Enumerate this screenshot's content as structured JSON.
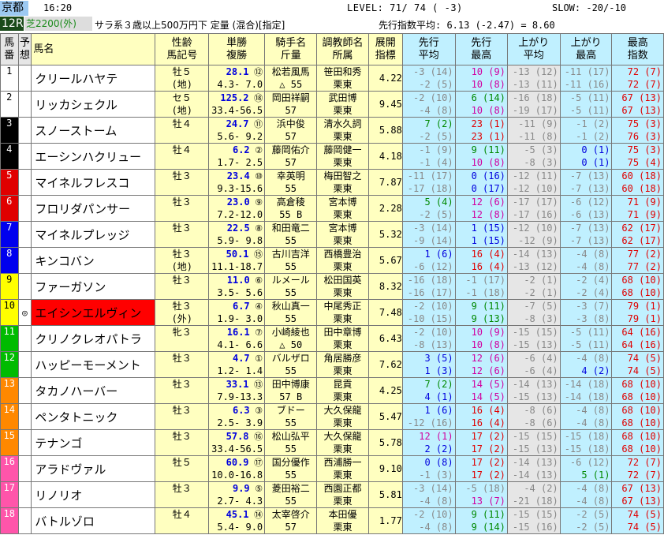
{
  "header": {
    "venue": "京都",
    "time": "16:20",
    "level": "LEVEL:  71/ 74 ( -3)",
    "slow": "SLOW: -20/-10",
    "race": "12R",
    "course": "芝2200(外)",
    "conditions": "サラ系３歳以上500万円下 定量 (混合)[指定]",
    "average": "先行指数平均:  6.13  (-2.47) =  8.60"
  },
  "columns": {
    "num": "馬\n番",
    "pred": "予\n想",
    "name": "馬名",
    "sex": "性齢\n馬記号",
    "odds": "単勝\n複勝",
    "jockey": "騎手名\n斤量",
    "trainer": "調教師名\n所属",
    "devel": "展開\n指標",
    "sa": "先行\n平均",
    "sm": "先行\n最高",
    "aa": "上がり\n平均",
    "am": "上がり\n最高",
    "mx": "最高\n指数"
  },
  "horses": [
    {
      "n": "1",
      "g": "#fff",
      "gt": "dark",
      "mark": "",
      "name": "クリールハヤテ",
      "nbg": "#fff",
      "s1": "牡５",
      "s2": "(地)",
      "o1": "28.1",
      "or": "⑫",
      "o2": "4.3- 7.0",
      "j1": "松若風馬",
      "j2": "△ 55",
      "t1": "笹田和秀",
      "t2": "栗東",
      "dv": "4.22",
      "a1": "-3 (14)",
      "a2": "-2 (5)",
      "b1": "10 (9)",
      "b2": "10 (8)",
      "c1": "-13 (12)",
      "c2": "-13 (11)",
      "d1": "-11 (17)",
      "d2": "-11 (16)",
      "e1": "72 (7)",
      "e2": "72 (7)"
    },
    {
      "n": "2",
      "g": "#fff",
      "gt": "dark",
      "mark": "",
      "name": "リッカシェクル",
      "nbg": "#fff",
      "s1": "セ５",
      "s2": "(地)",
      "o1": "125.2",
      "or": "⑱",
      "o2": "33.4-56.5",
      "j1": "岡田祥嗣",
      "j2": "57",
      "t1": "武田博",
      "t2": "栗東",
      "dv": "9.45",
      "a1": "-2 (10)",
      "a2": "-4 (8)",
      "b1": "6 (14)",
      "b2": "10 (8)",
      "c1": "-16 (18)",
      "c2": "-19 (17)",
      "d1": "-5 (11)",
      "d2": "-5 (11)",
      "e1": "67 (13)",
      "e2": "67 (13)"
    },
    {
      "n": "3",
      "g": "#000",
      "gt": "",
      "mark": "",
      "name": "スノーストーム",
      "nbg": "#fff",
      "s1": "牡４",
      "s2": "",
      "o1": "24.7",
      "or": "⑪",
      "o2": "5.6- 9.2",
      "j1": "浜中俊",
      "j2": "57",
      "t1": "清水久詞",
      "t2": "栗東",
      "dv": "5.88",
      "a1": "7 (2)",
      "a2": "-2 (5)",
      "b1": "23 (1)",
      "b2": "23 (1)",
      "c1": "-11 (9)",
      "c2": "-11 (8)",
      "d1": "-1 (2)",
      "d2": "-1 (2)",
      "e1": "75 (3)",
      "e2": "76 (3)"
    },
    {
      "n": "4",
      "g": "#000",
      "gt": "",
      "mark": "",
      "name": "エーシンハクリュー",
      "nbg": "#fff",
      "s1": "牡４",
      "s2": "",
      "o1": "6.2",
      "or": "②",
      "o2": "1.7- 2.5",
      "j1": "藤岡佑介",
      "j2": "57",
      "t1": "藤岡健一",
      "t2": "栗東",
      "dv": "4.18",
      "a1": "-1 (9)",
      "a2": "-1 (4)",
      "b1": "9 (11)",
      "b2": "10 (8)",
      "c1": "-5 (3)",
      "c2": "-8 (3)",
      "d1": "0 (1)",
      "d2": "0 (1)",
      "e1": "75 (3)",
      "e2": "75 (4)"
    },
    {
      "n": "5",
      "g": "#e00000",
      "gt": "",
      "mark": "",
      "name": "マイネルフレスコ",
      "nbg": "#fff",
      "s1": "牡３",
      "s2": "",
      "o1": "23.4",
      "or": "⑩",
      "o2": "9.3-15.6",
      "j1": "幸英明",
      "j2": "55",
      "t1": "梅田智之",
      "t2": "栗東",
      "dv": "7.87",
      "a1": "-11 (17)",
      "a2": "-17 (18)",
      "b1": "0 (16)",
      "b2": "0 (17)",
      "c1": "-12 (11)",
      "c2": "-12 (10)",
      "d1": "-7 (13)",
      "d2": "-7 (13)",
      "e1": "60 (18)",
      "e2": "60 (18)"
    },
    {
      "n": "6",
      "g": "#e00000",
      "gt": "",
      "mark": "",
      "name": "フロリダパンサー",
      "nbg": "#fff",
      "s1": "牡３",
      "s2": "",
      "o1": "23.0",
      "or": "⑨",
      "o2": "7.2-12.0",
      "j1": "高倉稜",
      "j2": "55 B",
      "t1": "宮本博",
      "t2": "栗東",
      "dv": "2.28",
      "a1": "5 (4)",
      "a2": "-2 (5)",
      "b1": "12 (6)",
      "b2": "12 (8)",
      "c1": "-17 (17)",
      "c2": "-17 (16)",
      "d1": "-6 (12)",
      "d2": "-6 (13)",
      "e1": "71 (9)",
      "e2": "71 (9)"
    },
    {
      "n": "7",
      "g": "#0000ee",
      "gt": "",
      "mark": "",
      "name": "マイネルプレッジ",
      "nbg": "#fff",
      "s1": "牡３",
      "s2": "",
      "o1": "22.5",
      "or": "⑧",
      "o2": "5.9- 9.8",
      "j1": "和田竜二",
      "j2": "55",
      "t1": "宮本博",
      "t2": "栗東",
      "dv": "5.32",
      "a1": "-3 (14)",
      "a2": "-9 (14)",
      "b1": "1 (15)",
      "b2": "1 (15)",
      "c1": "-12 (10)",
      "c2": "-12 (9)",
      "d1": "-7 (13)",
      "d2": "-7 (13)",
      "e1": "62 (17)",
      "e2": "62 (17)"
    },
    {
      "n": "8",
      "g": "#0000ee",
      "gt": "",
      "mark": "",
      "name": "キンコバン",
      "nbg": "#fff",
      "s1": "牡３",
      "s2": "(地)",
      "o1": "50.1",
      "or": "⑮",
      "o2": "11.1-18.7",
      "j1": "古川吉洋",
      "j2": "55",
      "t1": "西橋豊治",
      "t2": "栗東",
      "dv": "5.67",
      "a1": "1 (6)",
      "a2": "-6 (12)",
      "b1": "16 (4)",
      "b2": "16 (4)",
      "c1": "-14 (13)",
      "c2": "-13 (12)",
      "d1": "-4 (8)",
      "d2": "-4 (8)",
      "e1": "77 (2)",
      "e2": "77 (2)"
    },
    {
      "n": "9",
      "g": "#ffff00",
      "gt": "dark",
      "mark": "",
      "name": "ファーガソン",
      "nbg": "#fff",
      "s1": "牡３",
      "s2": "",
      "o1": "11.0",
      "or": "⑥",
      "o2": "3.5- 5.6",
      "j1": "ルメール",
      "j2": "55",
      "t1": "松田国英",
      "t2": "栗東",
      "dv": "8.32",
      "a1": "-16 (18)",
      "a2": "-16 (17)",
      "b1": "-1 (17)",
      "b2": "-1 (18)",
      "c1": "-2 (1)",
      "c2": "-2 (1)",
      "d1": "-2 (4)",
      "d2": "-2 (4)",
      "e1": "68 (10)",
      "e2": "68 (10)"
    },
    {
      "n": "10",
      "g": "#ffff00",
      "gt": "dark",
      "mark": "◎",
      "name": "エイシンエルヴィン",
      "nbg": "#ff0000",
      "s1": "牡３",
      "s2": "(外)",
      "o1": "6.7",
      "or": "④",
      "o2": "1.9- 3.0",
      "j1": "秋山真一",
      "j2": "55",
      "t1": "中尾秀正",
      "t2": "栗東",
      "dv": "7.48",
      "a1": "-2 (10)",
      "a2": "-10 (15)",
      "b1": "9 (11)",
      "b2": "9 (13)",
      "c1": "-7 (5)",
      "c2": "-8 (3)",
      "d1": "-3 (7)",
      "d2": "-3 (8)",
      "e1": "79 (1)",
      "e2": "79 (1)"
    },
    {
      "n": "11",
      "g": "#00bb00",
      "gt": "",
      "mark": "",
      "name": "クリノクレオパトラ",
      "nbg": "#fff",
      "s1": "牝３",
      "s2": "",
      "o1": "16.1",
      "or": "⑦",
      "o2": "4.1- 6.6",
      "j1": "小崎綾也",
      "j2": "△ 50",
      "t1": "田中章博",
      "t2": "栗東",
      "dv": "6.43",
      "a1": "-2 (10)",
      "a2": "-8 (13)",
      "b1": "10 (9)",
      "b2": "10 (8)",
      "c1": "-15 (15)",
      "c2": "-15 (13)",
      "d1": "-5 (11)",
      "d2": "-5 (11)",
      "e1": "64 (16)",
      "e2": "64 (16)"
    },
    {
      "n": "12",
      "g": "#00bb00",
      "gt": "",
      "mark": "",
      "name": "ハッピーモーメント",
      "nbg": "#fff",
      "s1": "牡３",
      "s2": "",
      "o1": "4.7",
      "or": "①",
      "o2": "1.2- 1.4",
      "j1": "バルザロ",
      "j2": "55",
      "t1": "角居勝彦",
      "t2": "栗東",
      "dv": "7.62",
      "a1": "3 (5)",
      "a2": "1 (3)",
      "b1": "12 (6)",
      "b2": "12 (6)",
      "c1": "-6 (4)",
      "c2": "-6 (4)",
      "d1": "-4 (8)",
      "d2": "4 (2)",
      "e1": "74 (5)",
      "e2": "74 (5)"
    },
    {
      "n": "13",
      "g": "#ff8800",
      "gt": "",
      "mark": "",
      "name": "タカノハーバー",
      "nbg": "#fff",
      "s1": "牡３",
      "s2": "",
      "o1": "33.1",
      "or": "⑬",
      "o2": "7.9-13.3",
      "j1": "田中博康",
      "j2": "57 B",
      "t1": "昆貢",
      "t2": "栗東",
      "dv": "4.25",
      "a1": "7 (2)",
      "a2": "4 (1)",
      "b1": "14 (5)",
      "b2": "14 (5)",
      "c1": "-14 (13)",
      "c2": "-15 (13)",
      "d1": "-14 (18)",
      "d2": "-14 (18)",
      "e1": "68 (10)",
      "e2": "68 (10)"
    },
    {
      "n": "14",
      "g": "#ff8800",
      "gt": "",
      "mark": "",
      "name": "ペンタトニック",
      "nbg": "#fff",
      "s1": "牡３",
      "s2": "",
      "o1": "6.3",
      "or": "③",
      "o2": "2.5- 3.9",
      "j1": "ブドー",
      "j2": "55",
      "t1": "大久保龍",
      "t2": "栗東",
      "dv": "5.47",
      "a1": "1 (6)",
      "a2": "-12 (16)",
      "b1": "16 (4)",
      "b2": "16 (4)",
      "c1": "-8 (6)",
      "c2": "-8 (6)",
      "d1": "-4 (8)",
      "d2": "-4 (8)",
      "e1": "68 (10)",
      "e2": "68 (10)"
    },
    {
      "n": "15",
      "g": "#ff8800",
      "gt": "",
      "mark": "",
      "name": "テナンゴ",
      "nbg": "#fff",
      "s1": "牡３",
      "s2": "",
      "o1": "57.8",
      "or": "⑯",
      "o2": "33.4-56.5",
      "j1": "松山弘平",
      "j2": "55",
      "t1": "大久保龍",
      "t2": "栗東",
      "dv": "5.78",
      "a1": "12 (1)",
      "a2": "2 (2)",
      "b1": "17 (2)",
      "b2": "17 (2)",
      "c1": "-15 (15)",
      "c2": "-15 (13)",
      "d1": "-15 (18)",
      "d2": "-15 (18)",
      "e1": "68 (10)",
      "e2": "68 (10)"
    },
    {
      "n": "16",
      "g": "#ff55aa",
      "gt": "",
      "mark": "",
      "name": "アラドヴァル",
      "nbg": "#fff",
      "s1": "牡５",
      "s2": "",
      "o1": "60.9",
      "or": "⑰",
      "o2": "10.0-16.8",
      "j1": "国分優作",
      "j2": "55",
      "t1": "西浦勝一",
      "t2": "栗東",
      "dv": "9.10",
      "a1": "0 (8)",
      "a2": "-1 (3)",
      "b1": "17 (2)",
      "b2": "17 (2)",
      "c1": "-14 (13)",
      "c2": "-14 (13)",
      "d1": "-6 (12)",
      "d2": "5 (1)",
      "e1": "72 (7)",
      "e2": "72 (7)"
    },
    {
      "n": "17",
      "g": "#ff55aa",
      "gt": "",
      "mark": "",
      "name": "リノリオ",
      "nbg": "#fff",
      "s1": "牡３",
      "s2": "",
      "o1": "9.9",
      "or": "⑤",
      "o2": "2.7- 4.3",
      "j1": "菱田裕二",
      "j2": "55",
      "t1": "西園正都",
      "t2": "栗東",
      "dv": "5.81",
      "a1": "-3 (14)",
      "a2": "-4 (8)",
      "b1": "-5 (18)",
      "b2": "13 (7)",
      "c1": "-4 (2)",
      "c2": "-21 (18)",
      "d1": "-4 (8)",
      "d2": "-4 (8)",
      "e1": "67 (13)",
      "e2": "67 (13)"
    },
    {
      "n": "18",
      "g": "#ff55aa",
      "gt": "",
      "mark": "",
      "name": "バトルゾロ",
      "nbg": "#fff",
      "s1": "牡４",
      "s2": "",
      "o1": "45.1",
      "or": "⑭",
      "o2": "5.4- 9.0",
      "j1": "太宰啓介",
      "j2": "57",
      "t1": "本田優",
      "t2": "栗東",
      "dv": "1.77",
      "a1": "-2 (10)",
      "a2": "-4 (8)",
      "b1": "9 (11)",
      "b2": "9 (14)",
      "c1": "-15 (15)",
      "c2": "-15 (16)",
      "d1": "-2 (5)",
      "d2": "-2 (5)",
      "e1": "74 (5)",
      "e2": "74 (5)"
    }
  ]
}
